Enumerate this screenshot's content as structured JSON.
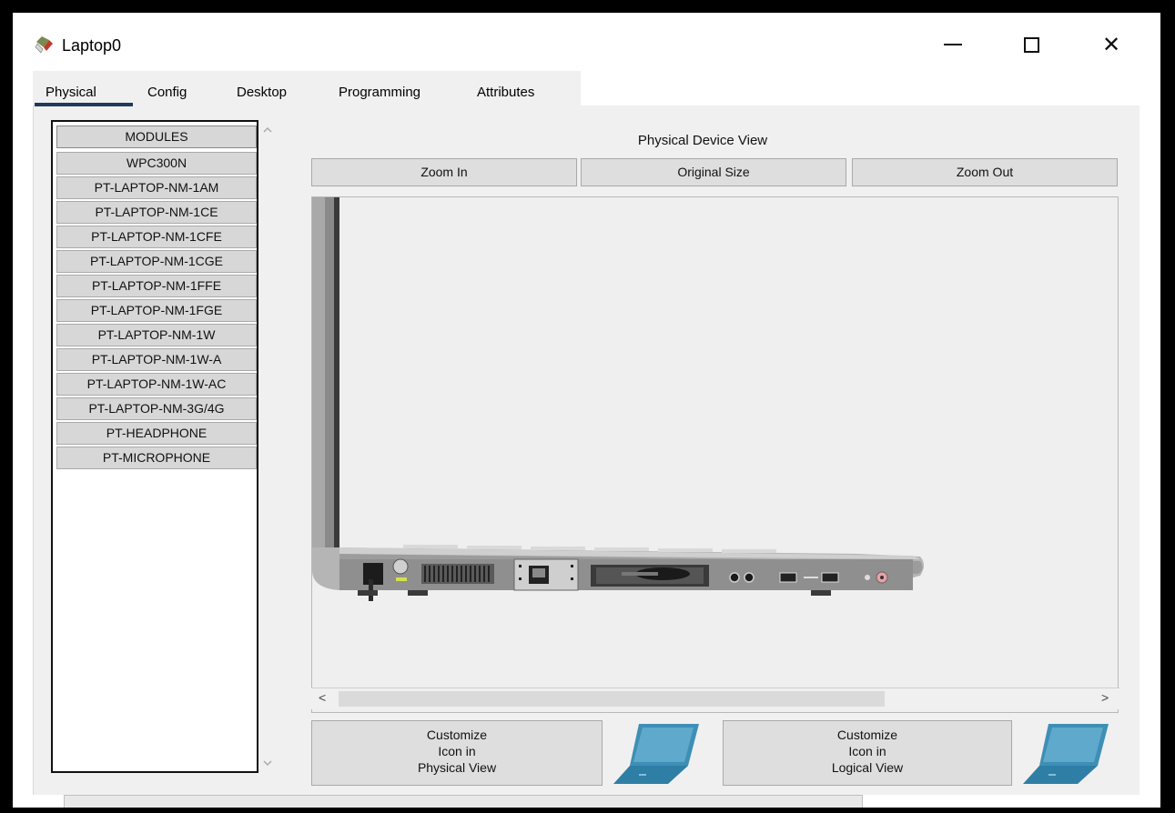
{
  "window": {
    "title": "Laptop0",
    "controls": {
      "minimize": "minimize",
      "maximize": "maximize",
      "close": "✕"
    }
  },
  "tabs": [
    {
      "label": "Physical",
      "active": true
    },
    {
      "label": "Config"
    },
    {
      "label": "Desktop"
    },
    {
      "label": "Programming"
    },
    {
      "label": "Attributes"
    }
  ],
  "modules": {
    "items": [
      "MODULES",
      "WPC300N",
      "PT-LAPTOP-NM-1AM",
      "PT-LAPTOP-NM-1CE",
      "PT-LAPTOP-NM-1CFE",
      "PT-LAPTOP-NM-1CGE",
      "PT-LAPTOP-NM-1FFE",
      "PT-LAPTOP-NM-1FGE",
      "PT-LAPTOP-NM-1W",
      "PT-LAPTOP-NM-1W-A",
      "PT-LAPTOP-NM-1W-AC",
      "PT-LAPTOP-NM-3G/4G",
      "PT-HEADPHONE",
      "PT-MICROPHONE"
    ]
  },
  "physical_view": {
    "title": "Physical Device View",
    "zoom_in": "Zoom In",
    "original_size": "Original Size",
    "zoom_out": "Zoom Out"
  },
  "customize": {
    "physical": [
      "Customize",
      "Icon in",
      "Physical View"
    ],
    "logical": [
      "Customize",
      "Icon in",
      "Logical View"
    ]
  },
  "colors": {
    "tab_underline": "#1f3a5c",
    "laptop_icon": "#3e8fb5"
  }
}
